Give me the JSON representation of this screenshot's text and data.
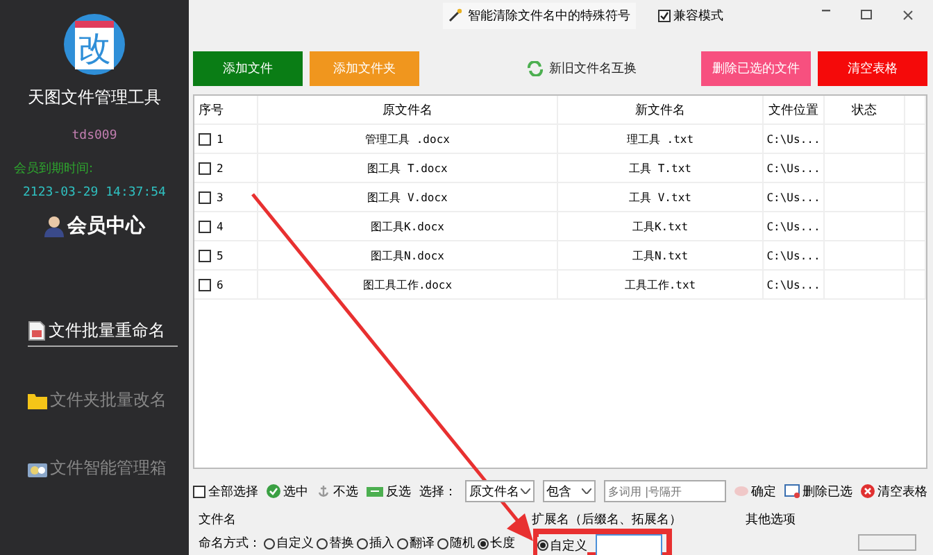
{
  "sidebar": {
    "logo_glyph": "改",
    "app_name": "天图文件管理工具",
    "username": "tds009",
    "expiry_label": "会员到期时间:",
    "expiry_date": "2123-03-29 14:37:54",
    "member_center": "会员中心",
    "nav": [
      {
        "label": "文件批量重命名",
        "selected": true,
        "kind": "document"
      },
      {
        "label": "文件夹批量改名",
        "selected": false,
        "kind": "folder"
      },
      {
        "label": "文件智能管理箱",
        "selected": false,
        "kind": "toolbox"
      }
    ]
  },
  "title_bar": {
    "clean_button": "智能清除文件名中的特殊符号",
    "compat": {
      "label": "兼容模式",
      "checked": true
    }
  },
  "actions": [
    {
      "label": "添加文件",
      "color": "#0a7d15"
    },
    {
      "label": "添加文件夹",
      "color": "#f0961e"
    },
    {
      "label": "新旧文件名互换"
    },
    {
      "label": "删除已选的文件",
      "color": "#f7507f"
    },
    {
      "label": "清空表格",
      "color": "#f50a0a"
    }
  ],
  "table": {
    "columns": [
      "序号",
      "原文件名",
      "新文件名",
      "文件位置",
      "状态"
    ],
    "rows": [
      {
        "index": "1",
        "checked": false,
        "original": "管理工具 .docx",
        "new": "理工具 .txt",
        "location": "C:\\Us..."
      },
      {
        "index": "2",
        "checked": false,
        "original": "图工具 T.docx",
        "new": "工具 T.txt",
        "location": "C:\\Us..."
      },
      {
        "index": "3",
        "checked": false,
        "original": "图工具 V.docx",
        "new": "工具 V.txt",
        "location": "C:\\Us..."
      },
      {
        "index": "4",
        "checked": false,
        "original": "图工具K.docx",
        "new": "工具K.txt",
        "location": "C:\\Us..."
      },
      {
        "index": "5",
        "checked": false,
        "original": "图工具N.docx",
        "new": "工具N.txt",
        "location": "C:\\Us..."
      },
      {
        "index": "6",
        "checked": false,
        "original": "图工具工作.docx",
        "new": "工具工作.txt",
        "location": "C:\\Us..."
      }
    ]
  },
  "toolbar": {
    "select_all": {
      "label": "全部选择",
      "checked": false
    },
    "select": "选中",
    "deselect": "不选",
    "invert": "反选",
    "filter_label": "选择：",
    "field_select": "原文件名",
    "match_select": "包含",
    "keyword_placeholder": "多词用 |号隔开",
    "confirm": "确定",
    "delete_selected": "删除已选",
    "clear_table": "清空表格"
  },
  "filename_group": {
    "title": "文件名",
    "mode_label": "命名方式：",
    "modes": [
      {
        "label": "自定义",
        "selected": false
      },
      {
        "label": "替换",
        "selected": false
      },
      {
        "label": "插入",
        "selected": false
      },
      {
        "label": "翻译",
        "selected": false
      },
      {
        "label": "随机",
        "selected": false
      },
      {
        "label": "长度",
        "selected": true
      }
    ]
  },
  "extension_group": {
    "title": "扩展名（后缀名、拓展名）",
    "modes": [
      {
        "label": "自定义",
        "selected": true
      }
    ]
  },
  "other_group": {
    "title": "其他选项"
  }
}
